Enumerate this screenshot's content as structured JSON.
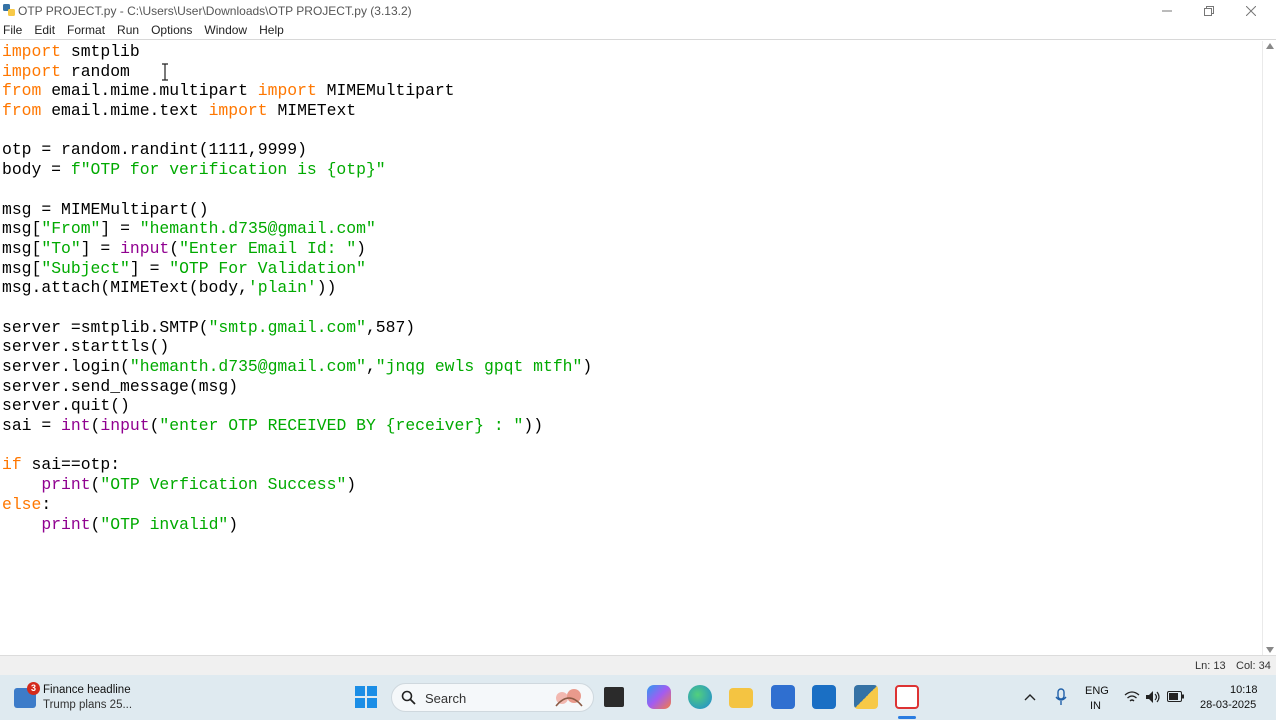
{
  "window": {
    "title": "OTP PROJECT.py - C:\\Users\\User\\Downloads\\OTP PROJECT.py (3.13.2)"
  },
  "menu": [
    "File",
    "Edit",
    "Format",
    "Run",
    "Options",
    "Window",
    "Help"
  ],
  "editor": {
    "lines": [
      [
        {
          "t": "import",
          "c": "kw"
        },
        {
          "t": " smtplib",
          "c": ""
        }
      ],
      [
        {
          "t": "import",
          "c": "kw"
        },
        {
          "t": " random",
          "c": ""
        }
      ],
      [
        {
          "t": "from",
          "c": "kw"
        },
        {
          "t": " email.mime.multipart ",
          "c": ""
        },
        {
          "t": "import",
          "c": "kw"
        },
        {
          "t": " MIMEMultipart",
          "c": ""
        }
      ],
      [
        {
          "t": "from",
          "c": "kw"
        },
        {
          "t": " email.mime.text ",
          "c": ""
        },
        {
          "t": "import",
          "c": "kw"
        },
        {
          "t": " MIMEText",
          "c": ""
        }
      ],
      [],
      [
        {
          "t": "otp = random.randint(1111,9999)",
          "c": ""
        }
      ],
      [
        {
          "t": "body = ",
          "c": ""
        },
        {
          "t": "f\"OTP for verification is {otp}\"",
          "c": "str"
        }
      ],
      [],
      [
        {
          "t": "msg = MIMEMultipart()",
          "c": ""
        }
      ],
      [
        {
          "t": "msg[",
          "c": ""
        },
        {
          "t": "\"From\"",
          "c": "str"
        },
        {
          "t": "] = ",
          "c": ""
        },
        {
          "t": "\"hemanth.d735@gmail.com\"",
          "c": "str"
        }
      ],
      [
        {
          "t": "msg[",
          "c": ""
        },
        {
          "t": "\"To\"",
          "c": "str"
        },
        {
          "t": "] = ",
          "c": ""
        },
        {
          "t": "input",
          "c": "bi"
        },
        {
          "t": "(",
          "c": ""
        },
        {
          "t": "\"Enter Email Id: \"",
          "c": "str"
        },
        {
          "t": ")",
          "c": ""
        }
      ],
      [
        {
          "t": "msg[",
          "c": ""
        },
        {
          "t": "\"Subject\"",
          "c": "str"
        },
        {
          "t": "] = ",
          "c": ""
        },
        {
          "t": "\"OTP For Validation\"",
          "c": "str"
        }
      ],
      [
        {
          "t": "msg.attach(MIMEText(body,",
          "c": ""
        },
        {
          "t": "'plain'",
          "c": "str"
        },
        {
          "t": "))",
          "c": ""
        }
      ],
      [],
      [
        {
          "t": "server =smtplib.SMTP(",
          "c": ""
        },
        {
          "t": "\"smtp.gmail.com\"",
          "c": "str"
        },
        {
          "t": ",587)",
          "c": ""
        }
      ],
      [
        {
          "t": "server.starttls()",
          "c": ""
        }
      ],
      [
        {
          "t": "server.login(",
          "c": ""
        },
        {
          "t": "\"hemanth.d735@gmail.com\"",
          "c": "str"
        },
        {
          "t": ",",
          "c": ""
        },
        {
          "t": "\"jnqg ewls gpqt mtfh\"",
          "c": "str"
        },
        {
          "t": ")",
          "c": ""
        }
      ],
      [
        {
          "t": "server.send_message(msg)",
          "c": ""
        }
      ],
      [
        {
          "t": "server.quit()",
          "c": ""
        }
      ],
      [
        {
          "t": "sai = ",
          "c": ""
        },
        {
          "t": "int",
          "c": "bi"
        },
        {
          "t": "(",
          "c": ""
        },
        {
          "t": "input",
          "c": "bi"
        },
        {
          "t": "(",
          "c": ""
        },
        {
          "t": "\"enter OTP RECEIVED BY {receiver} : \"",
          "c": "str"
        },
        {
          "t": "))",
          "c": ""
        }
      ],
      [],
      [
        {
          "t": "if",
          "c": "kw"
        },
        {
          "t": " sai==otp:",
          "c": ""
        }
      ],
      [
        {
          "t": "    ",
          "c": ""
        },
        {
          "t": "print",
          "c": "bi"
        },
        {
          "t": "(",
          "c": ""
        },
        {
          "t": "\"OTP Verfication Success\"",
          "c": "str"
        },
        {
          "t": ")",
          "c": ""
        }
      ],
      [
        {
          "t": "else",
          "c": "kw"
        },
        {
          "t": ":",
          "c": ""
        }
      ],
      [
        {
          "t": "    ",
          "c": ""
        },
        {
          "t": "print",
          "c": "bi"
        },
        {
          "t": "(",
          "c": ""
        },
        {
          "t": "\"OTP invalid\"",
          "c": "str"
        },
        {
          "t": ")",
          "c": ""
        }
      ]
    ]
  },
  "status": {
    "line": "Ln: 13",
    "col": "Col: 34"
  },
  "taskbar": {
    "news_badge": "3",
    "news_title": "Finance headline",
    "news_sub": "Trump plans 25...",
    "search_label": "Search",
    "lang_1": "ENG",
    "lang_2": "IN",
    "time": "10:18",
    "date": "28-03-2025"
  },
  "colors": {
    "keyword": "#ff7700",
    "string": "#00aa00",
    "builtin": "#900090"
  }
}
